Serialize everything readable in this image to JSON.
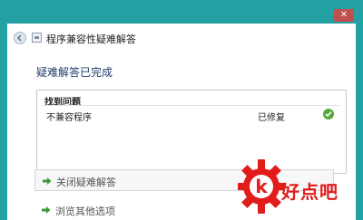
{
  "window": {
    "title": "程序兼容性疑难解答",
    "close_glyph": "✕"
  },
  "main": {
    "heading": "疑难解答已完成",
    "panel": {
      "header": "找到问题",
      "rows": [
        {
          "name": "不兼容程序",
          "status": "已修复",
          "status_icon": "check-icon"
        }
      ]
    },
    "actions": [
      {
        "label": "关闭疑难解答",
        "icon": "arrow-right-icon"
      },
      {
        "label": "浏览其他选项",
        "icon": "arrow-right-icon"
      }
    ]
  },
  "watermark": {
    "text": "好点吧",
    "logo_letter": "k"
  },
  "colors": {
    "frame": "#23a0a2",
    "close": "#c0504d",
    "heading": "#1f3e6a",
    "check": "#57a83a",
    "arrow": "#3a9a3a",
    "watermark": "#e21b1b"
  }
}
